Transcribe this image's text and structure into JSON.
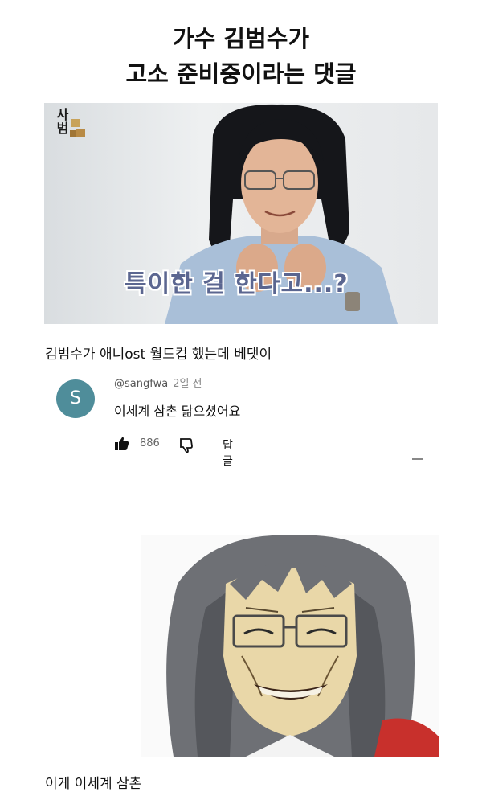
{
  "headline": {
    "line1": "가수 김범수가",
    "line2": "고소 준비중이라는 댓글"
  },
  "photo": {
    "channel_logo_text": "사범",
    "subtitle": "특이한 걸 한다고...?"
  },
  "caption1": "김범수가 애니ost 월드컵 했는데 베댓이",
  "comment": {
    "avatar_letter": "S",
    "username": "@sangfwa",
    "time": "2일 전",
    "text": "이세계 삼촌 닮으셨어요",
    "likes": "886",
    "reply_label": "답글"
  },
  "caption2": "이게 이세계 삼촌",
  "colors": {
    "avatar": "#4f8d9a",
    "subtitle": "#5b6690"
  }
}
